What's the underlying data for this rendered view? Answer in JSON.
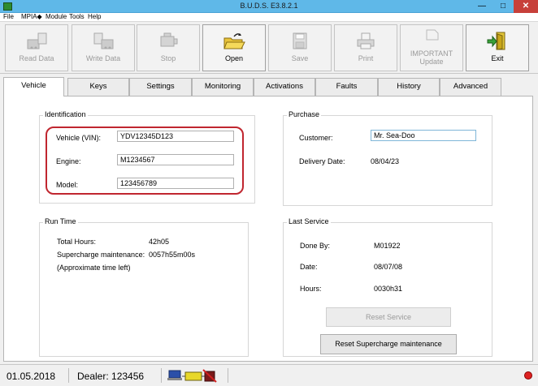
{
  "window": {
    "title": "B.U.D.S. E3.8.2.1",
    "min_glyph": "—",
    "max_glyph": "□",
    "close_glyph": "✕"
  },
  "menu": [
    "File",
    "MPIA◆",
    "Module",
    "Tools",
    "Help"
  ],
  "toolbar": [
    {
      "label": "Read Data",
      "icon": "read-data-icon",
      "enabled": false
    },
    {
      "label": "Write Data",
      "icon": "write-data-icon",
      "enabled": false
    },
    {
      "label": "Stop",
      "icon": "engine-stop-icon",
      "enabled": false
    },
    {
      "label": "Open",
      "icon": "open-folder-icon",
      "enabled": true
    },
    {
      "label": "Save",
      "icon": "save-disk-icon",
      "enabled": false
    },
    {
      "label": "Print",
      "icon": "printer-icon",
      "enabled": false
    },
    {
      "label": "IMPORTANT",
      "label2": "Update",
      "icon": "update-icon",
      "enabled": false
    },
    {
      "label": "Exit",
      "icon": "exit-door-icon",
      "enabled": true
    }
  ],
  "tabs": [
    "Vehicle",
    "Keys",
    "Settings",
    "Monitoring",
    "Activations",
    "Faults",
    "History",
    "Advanced"
  ],
  "selected_tab": "Vehicle",
  "identification": {
    "title": "Identification",
    "vin_label": "Vehicle (VIN):",
    "vin_value": "YDV12345D123",
    "engine_label": "Engine:",
    "engine_value": "M1234567",
    "model_label": "Model:",
    "model_value": "123456789"
  },
  "purchase": {
    "title": "Purchase",
    "customer_label": "Customer:",
    "customer_value": "Mr. Sea-Doo",
    "delivery_label": "Delivery Date:",
    "delivery_value": "08/04/23"
  },
  "run_time": {
    "title": "Run Time",
    "hours_label": "Total Hours:",
    "hours_value": "42h05",
    "supercharge_label": "Supercharge maintenance:",
    "supercharge_value": "0057h55m00s",
    "note": "(Approximate time left)"
  },
  "last_service": {
    "title": "Last Service",
    "done_by_label": "Done By:",
    "done_by_value": "M01922",
    "date_label": "Date:",
    "date_value": "08/07/08",
    "hours_label": "Hours:",
    "hours_value": "0030h31",
    "reset_service": "Reset Service",
    "reset_supercharge": "Reset Supercharge maintenance"
  },
  "status": {
    "date": "01.05.2018",
    "dealer": "Dealer: 123456"
  },
  "colors": {
    "highlight": "#c0262f",
    "titlebar": "#5fb8e8",
    "close": "#c7403a"
  }
}
